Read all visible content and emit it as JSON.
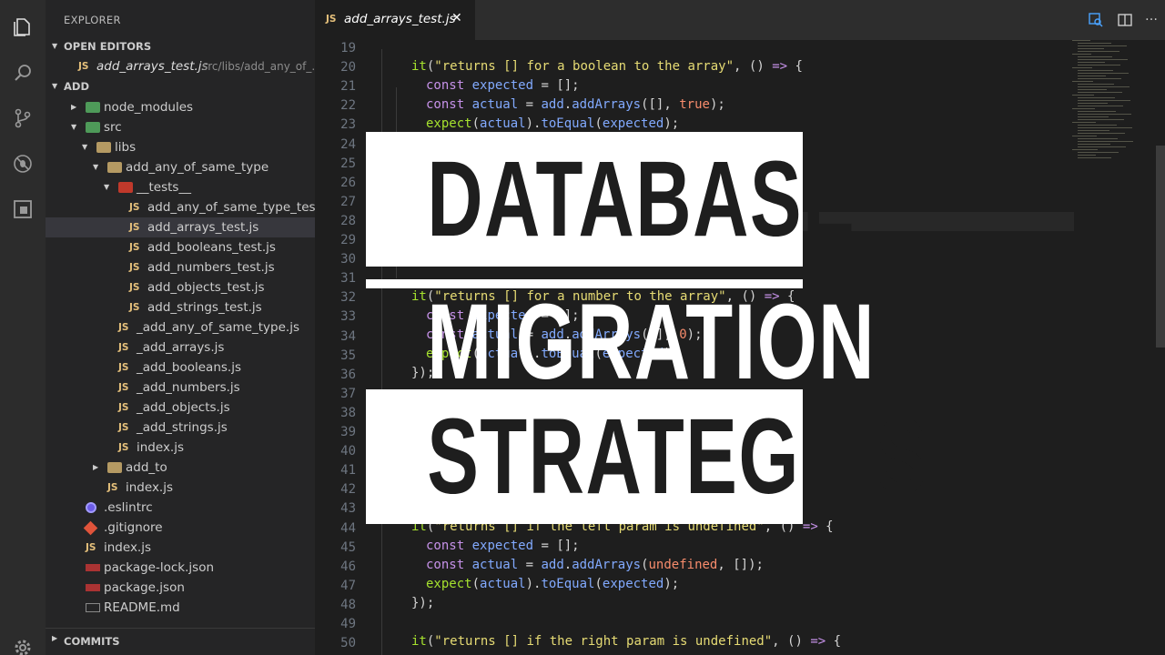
{
  "sidebar": {
    "title": "EXPLORER",
    "open_editors": {
      "header": "OPEN EDITORS",
      "file": "add_arrays_test.js",
      "path": "src/libs/add_any_of_..."
    },
    "root": "ADD",
    "tree": [
      {
        "label": "node_modules",
        "icon": "folder-node-icon"
      },
      {
        "label": "src",
        "icon": "folder-src-icon"
      },
      {
        "label": "libs",
        "icon": "folder-icon"
      },
      {
        "label": "add_any_of_same_type",
        "icon": "folder-icon"
      },
      {
        "label": "__tests__",
        "icon": "folder-tests-icon"
      },
      {
        "label": "add_any_of_same_type_test.js",
        "icon": "js-icon"
      },
      {
        "label": "add_arrays_test.js",
        "icon": "js-icon"
      },
      {
        "label": "add_booleans_test.js",
        "icon": "js-icon"
      },
      {
        "label": "add_numbers_test.js",
        "icon": "js-icon"
      },
      {
        "label": "add_objects_test.js",
        "icon": "js-icon"
      },
      {
        "label": "add_strings_test.js",
        "icon": "js-icon"
      },
      {
        "label": "_add_any_of_same_type.js",
        "icon": "js-icon"
      },
      {
        "label": "_add_arrays.js",
        "icon": "js-icon"
      },
      {
        "label": "_add_booleans.js",
        "icon": "js-icon"
      },
      {
        "label": "_add_numbers.js",
        "icon": "js-icon"
      },
      {
        "label": "_add_objects.js",
        "icon": "js-icon"
      },
      {
        "label": "_add_strings.js",
        "icon": "js-icon"
      },
      {
        "label": "index.js",
        "icon": "js-icon"
      },
      {
        "label": "add_to",
        "icon": "folder-icon"
      },
      {
        "label": "index.js",
        "icon": "js-icon"
      },
      {
        "label": ".eslintrc",
        "icon": "eslint-icon"
      },
      {
        "label": ".gitignore",
        "icon": "git-icon"
      },
      {
        "label": "index.js",
        "icon": "js-icon"
      },
      {
        "label": "package-lock.json",
        "icon": "npm-icon"
      },
      {
        "label": "package.json",
        "icon": "npm-icon"
      },
      {
        "label": "README.md",
        "icon": "markdown-icon"
      }
    ],
    "commits": "COMMITS"
  },
  "editor": {
    "tab": {
      "badge": "JS",
      "name": "add_arrays_test.js",
      "close": "✕"
    },
    "line_numbers": [
      "19",
      "20",
      "21",
      "22",
      "23",
      "24",
      "25",
      "26",
      "27",
      "28",
      "29",
      "30",
      "31",
      "32",
      "33",
      "34",
      "35",
      "36",
      "37",
      "38",
      "39",
      "40",
      "41",
      "42",
      "43",
      "44",
      "45",
      "46",
      "47",
      "48",
      "49",
      "50"
    ]
  },
  "overlay": {
    "line1": "DATABASE",
    "line2": "MIGRATION",
    "line3": "STRATEGIES"
  },
  "colors": {
    "accent_string": "#e6db74",
    "accent_keyword": "#c792ea",
    "accent_function": "#a6e22e",
    "accent_variable": "#82aaff"
  }
}
